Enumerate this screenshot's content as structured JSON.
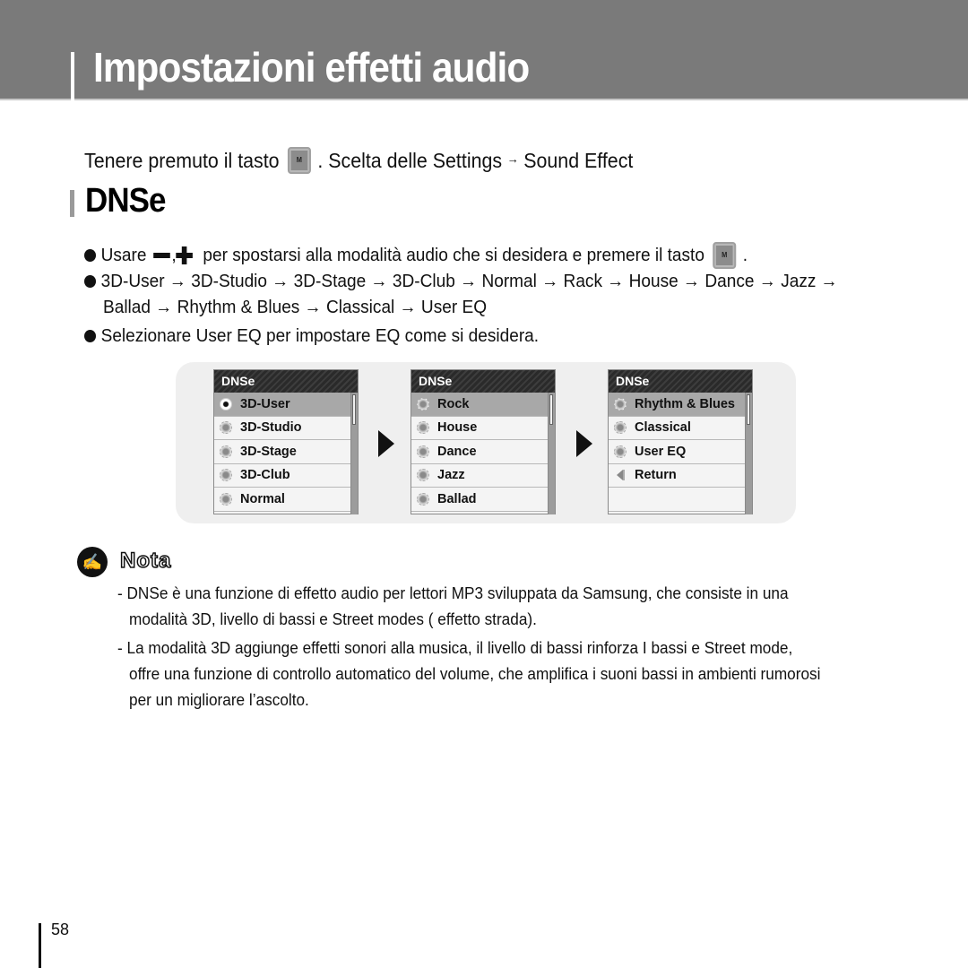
{
  "header": {
    "title": "Impostazioni effetti audio"
  },
  "instruction": {
    "prefix": "Tenere premuto il tasto",
    "key_label": "M",
    "middle": ". Scelta delle Settings",
    "arrow": "→",
    "suffix": "Sound Effect"
  },
  "section": {
    "title": "DNSe"
  },
  "bullets": {
    "b1": {
      "prefix": "Usare",
      "sep": ",",
      "suffix": "per spostarsi alla modalità audio che si desidera e premere il tasto",
      "key_label": "M",
      "end": "."
    },
    "b2": {
      "line1": "3D-User → 3D-Studio → 3D-Stage → 3D-Club → Normal → Rack → House → Dance → Jazz →",
      "line2": "Ballad → Rhythm & Blues → Classical → User EQ"
    },
    "b3": "Selezionare User EQ per impostare EQ come si desidera."
  },
  "screens": [
    {
      "title": "DNSe",
      "items": [
        {
          "label": "3D-User",
          "icon": "radio-selected",
          "selected": true
        },
        {
          "label": "3D-Studio",
          "icon": "radio"
        },
        {
          "label": "3D-Stage",
          "icon": "radio"
        },
        {
          "label": "3D-Club",
          "icon": "radio"
        },
        {
          "label": "Normal",
          "icon": "radio"
        }
      ]
    },
    {
      "title": "DNSe",
      "items": [
        {
          "label": "Rock",
          "icon": "radio",
          "selected": true
        },
        {
          "label": "House",
          "icon": "radio"
        },
        {
          "label": "Dance",
          "icon": "radio"
        },
        {
          "label": "Jazz",
          "icon": "radio"
        },
        {
          "label": "Ballad",
          "icon": "radio"
        }
      ]
    },
    {
      "title": "DNSe",
      "items": [
        {
          "label": "Rhythm & Blues",
          "icon": "radio",
          "selected": true
        },
        {
          "label": "Classical",
          "icon": "radio"
        },
        {
          "label": "User EQ",
          "icon": "radio"
        },
        {
          "label": "Return",
          "icon": "back"
        },
        {
          "label": "",
          "icon": "none"
        }
      ]
    }
  ],
  "nota": {
    "label": "Nota",
    "icon": "pen-note-icon",
    "items": [
      {
        "line1": "- DNSe è una funzione di effetto audio per lettori MP3 sviluppata da Samsung,  che consiste in una",
        "line2": "modalità 3D, livello di bassi e Street modes ( effetto strada)."
      },
      {
        "line1": "- La modalità 3D aggiunge effetti sonori alla musica, il livello di bassi rinforza I bassi e Street mode,",
        "line2": "offre una funzione di controllo automatico del volume, che amplifica i suoni bassi in ambienti rumorosi",
        "line3": "per un migliorare l’ascolto."
      }
    ]
  },
  "page_number": "58"
}
